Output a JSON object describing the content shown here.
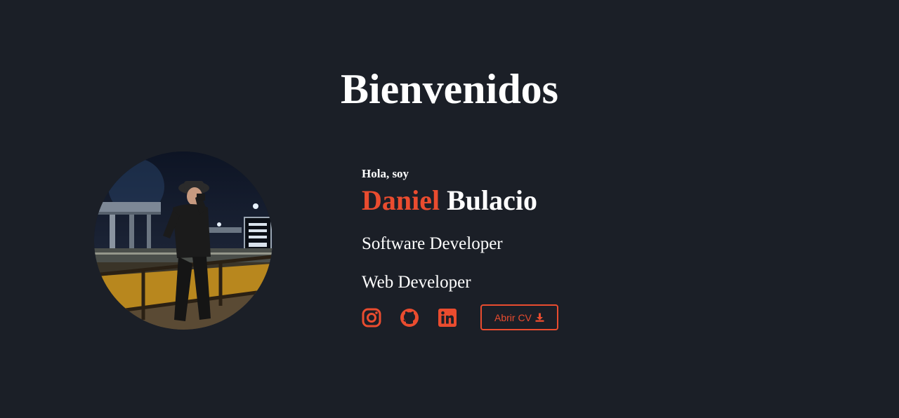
{
  "header": {
    "title": "Bienvenidos"
  },
  "profile": {
    "avatar_alt": "Daniel Bulacio",
    "greeting": "Hola, soy",
    "first_name": "Daniel",
    "last_name": "Bulacio",
    "roles": [
      "Software Developer",
      "Web Developer"
    ]
  },
  "social": [
    {
      "name": "instagram-icon",
      "label": "Instagram"
    },
    {
      "name": "github-icon",
      "label": "GitHub"
    },
    {
      "name": "linkedin-icon",
      "label": "LinkedIn"
    }
  ],
  "cv_button": {
    "label": "Abrir CV",
    "icon": "download-icon"
  },
  "colors": {
    "background": "#1b1f27",
    "accent": "#ea4c2f",
    "text": "#ffffff"
  }
}
